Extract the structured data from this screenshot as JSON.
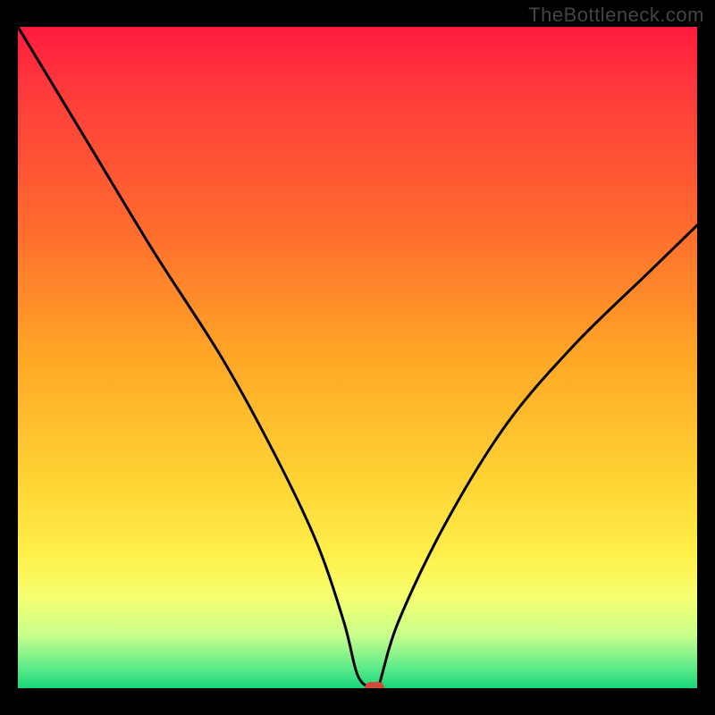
{
  "watermark": "TheBottleneck.com",
  "chart_data": {
    "type": "line",
    "title": "",
    "xlabel": "",
    "ylabel": "",
    "xlim": [
      0,
      100
    ],
    "ylim": [
      0,
      100
    ],
    "grid": false,
    "legend": false,
    "series": [
      {
        "name": "bottleneck-curve",
        "x": [
          0,
          10,
          20,
          30,
          38,
          44,
          48,
          50,
          52,
          53,
          56,
          63,
          72,
          82,
          93,
          100
        ],
        "values": [
          100,
          83,
          66,
          50,
          35,
          22,
          10,
          2,
          0,
          0,
          10,
          25,
          40,
          52,
          63,
          70
        ]
      }
    ],
    "marker": {
      "x": 52.5,
      "y": 0,
      "label": "optimal-point"
    },
    "gradient_bands": [
      {
        "y": 100,
        "color": "#ff1b3f"
      },
      {
        "y": 50,
        "color": "#ffa726"
      },
      {
        "y": 20,
        "color": "#fff04a"
      },
      {
        "y": 0,
        "color": "#18d67a"
      }
    ]
  }
}
